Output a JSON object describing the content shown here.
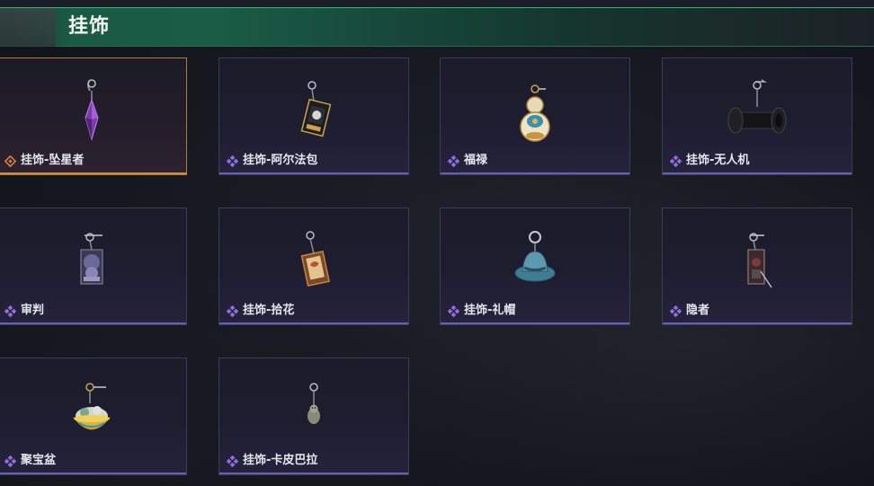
{
  "header": {
    "title": "挂饰"
  },
  "colors": {
    "header_green": "#1a5c46",
    "selected_border": "#b07a40",
    "rarity_purple": "#8f6fe0",
    "rarity_orange": "#e0813a"
  },
  "items": [
    {
      "name": "挂饰-坠星者",
      "icon": "crystal-pendant-icon",
      "rarity": "orange",
      "selected": true
    },
    {
      "name": "挂饰-阿尔法包",
      "icon": "card-pack-charm-icon",
      "rarity": "purple",
      "selected": false
    },
    {
      "name": "福禄",
      "icon": "gourd-charm-icon",
      "rarity": "purple",
      "selected": false
    },
    {
      "name": "挂饰-无人机",
      "icon": "drone-charm-icon",
      "rarity": "purple",
      "selected": false
    },
    {
      "name": "审判",
      "icon": "judgement-card-charm-icon",
      "rarity": "purple",
      "selected": false
    },
    {
      "name": "挂饰-拾花",
      "icon": "flower-card-charm-icon",
      "rarity": "purple",
      "selected": false
    },
    {
      "name": "挂饰-礼帽",
      "icon": "top-hat-charm-icon",
      "rarity": "purple",
      "selected": false
    },
    {
      "name": "隐者",
      "icon": "hermit-card-charm-icon",
      "rarity": "purple",
      "selected": false
    },
    {
      "name": "聚宝盆",
      "icon": "treasure-bowl-charm-icon",
      "rarity": "purple",
      "selected": false
    },
    {
      "name": "挂饰-卡皮巴拉",
      "icon": "capybara-charm-icon",
      "rarity": "purple",
      "selected": false
    }
  ]
}
